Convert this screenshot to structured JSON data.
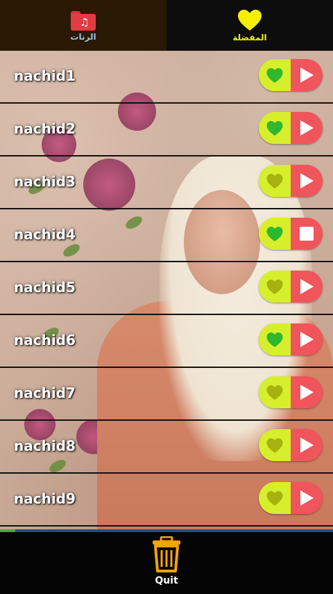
{
  "tabs": [
    {
      "label": "الرنات",
      "icon": "music-folder-icon",
      "color": "#e03c44"
    },
    {
      "label": "المفضلة",
      "icon": "heart-icon",
      "color": "#f4f000"
    }
  ],
  "tracks": [
    {
      "title": "nachid1",
      "favorite": true,
      "state": "play"
    },
    {
      "title": "nachid2",
      "favorite": true,
      "state": "play"
    },
    {
      "title": "nachid3",
      "favorite": false,
      "state": "play"
    },
    {
      "title": "nachid4",
      "favorite": true,
      "state": "stop"
    },
    {
      "title": "nachid5",
      "favorite": false,
      "state": "play"
    },
    {
      "title": "nachid6",
      "favorite": true,
      "state": "play"
    },
    {
      "title": "nachid7",
      "favorite": false,
      "state": "play"
    },
    {
      "title": "nachid8",
      "favorite": false,
      "state": "play"
    },
    {
      "title": "nachid9",
      "favorite": false,
      "state": "play"
    }
  ],
  "colors": {
    "fav_on": "#2db82d",
    "fav_off": "#a6b20e",
    "pill_left": "#d7ee2c",
    "pill_right": "#f0555b"
  },
  "playback_progress": 0.045,
  "quit": {
    "label": "Quit",
    "icon": "trash-can-icon"
  }
}
